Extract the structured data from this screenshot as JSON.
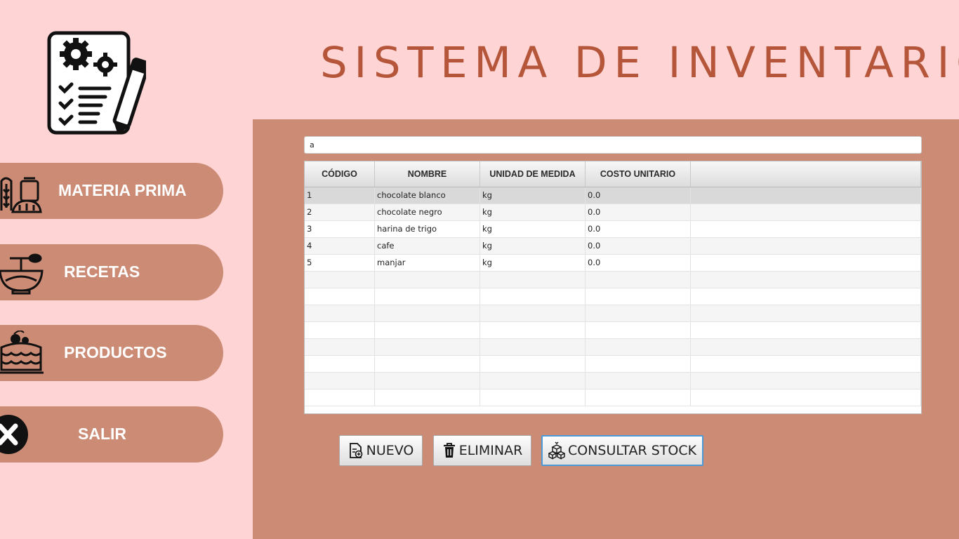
{
  "app": {
    "title": "SISTEMA DE INVENTARIO",
    "logo_icon": "checklist-gears-pencil-icon"
  },
  "sidebar": {
    "items": [
      {
        "label": "MATERIA PRIMA",
        "icon": "wheat-flour-icon"
      },
      {
        "label": "RECETAS",
        "icon": "mixing-bowl-icon"
      },
      {
        "label": "PRODUCTOS",
        "icon": "cake-icon"
      },
      {
        "label": "SALIR",
        "icon": "close-circle-icon"
      }
    ]
  },
  "search": {
    "value": "a",
    "placeholder": ""
  },
  "table": {
    "columns": [
      "CÓDIGO",
      "NOMBRE",
      "UNIDAD DE MEDIDA",
      "COSTO UNITARIO",
      ""
    ],
    "rows": [
      [
        "1",
        "chocolate blanco",
        "kg",
        "0.0"
      ],
      [
        "2",
        "chocolate negro",
        "kg",
        "0.0"
      ],
      [
        "3",
        "harina de trigo",
        "kg",
        "0.0"
      ],
      [
        "4",
        "cafe",
        "kg",
        "0.0"
      ],
      [
        "5",
        "manjar",
        "kg",
        "0.0"
      ]
    ],
    "selected_row": 0
  },
  "actions": {
    "new_label": "NUEVO",
    "new_icon": "new-document-icon",
    "delete_label": "ELIMINAR",
    "delete_icon": "trash-icon",
    "stock_label": "CONSULTAR STOCK",
    "stock_icon": "stock-boxes-icon"
  },
  "colors": {
    "background": "#ffd4d5",
    "panel": "#cb8b74",
    "title": "#b5563a",
    "accent_focus": "#4a9ad9"
  }
}
